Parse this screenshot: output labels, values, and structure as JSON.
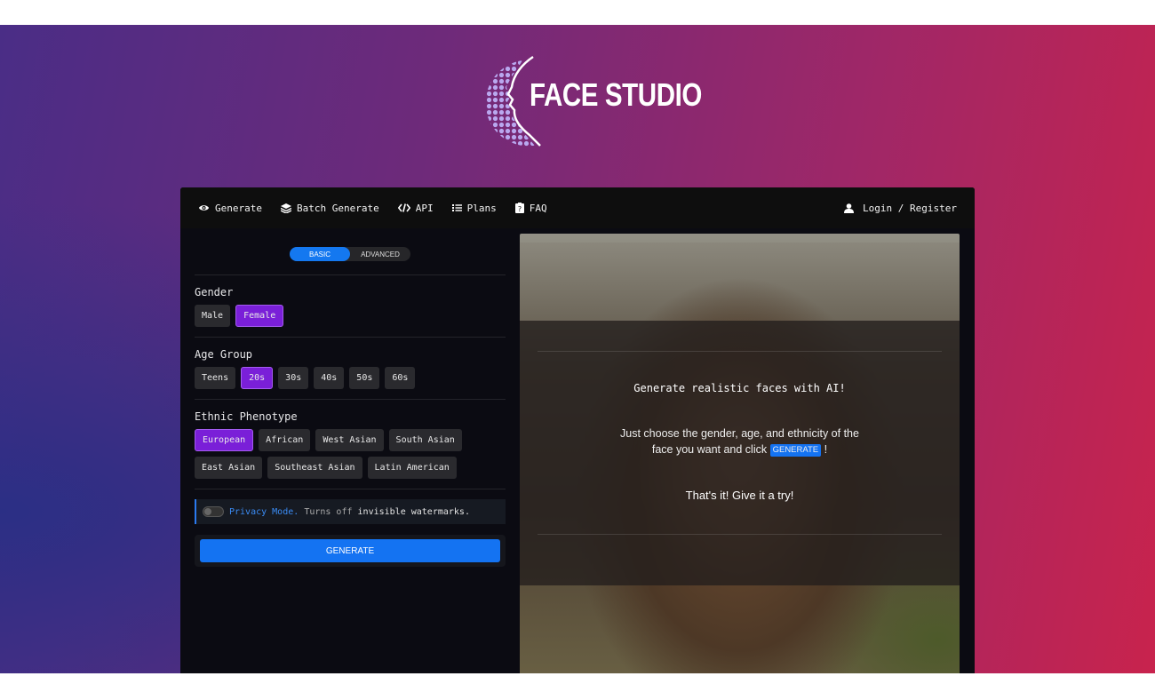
{
  "brand": {
    "name": "FACE STUDIO"
  },
  "nav": {
    "items": [
      {
        "label": "Generate",
        "icon": "eye-icon"
      },
      {
        "label": "Batch Generate",
        "icon": "layers-icon"
      },
      {
        "label": "API",
        "icon": "code-icon"
      },
      {
        "label": "Plans",
        "icon": "list-icon"
      },
      {
        "label": "FAQ",
        "icon": "help-icon"
      }
    ],
    "login": {
      "label": "Login / Register",
      "icon": "user-icon"
    }
  },
  "mode_toggle": {
    "basic": "BASIC",
    "advanced": "ADVANCED",
    "selected": "BASIC"
  },
  "gender": {
    "label": "Gender",
    "options": [
      "Male",
      "Female"
    ],
    "selected": "Female"
  },
  "age": {
    "label": "Age Group",
    "options": [
      "Teens",
      "20s",
      "30s",
      "40s",
      "50s",
      "60s"
    ],
    "selected": "20s"
  },
  "ethnicity": {
    "label": "Ethnic Phenotype",
    "options": [
      "European",
      "African",
      "West Asian",
      "South Asian",
      "East Asian",
      "Southeast Asian",
      "Latin American"
    ],
    "selected": "European"
  },
  "privacy": {
    "link": "Privacy Mode.",
    "text1": "Turns off",
    "text2": "invisible watermarks.",
    "enabled": false
  },
  "generate_button": "GENERATE",
  "overlay": {
    "title": "Generate realistic faces with AI!",
    "desc_before": "Just choose the gender, age, and ethnicity of the face you want and click",
    "desc_button": "GENERATE",
    "desc_after": "!",
    "cta": "That's it! Give it a try!"
  },
  "colors": {
    "accent": "#1473f2",
    "selected": "#7a1fd8"
  }
}
